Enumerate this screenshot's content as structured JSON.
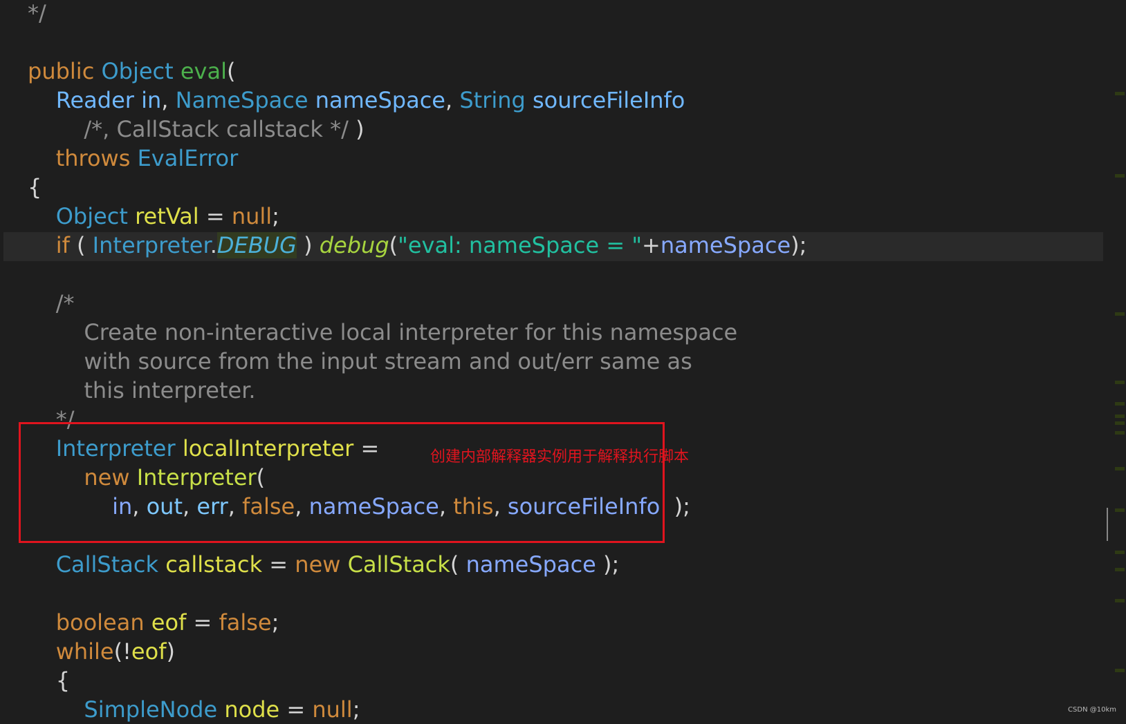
{
  "editor": {
    "lines": [
      [
        {
          "t": "*/",
          "c": "cm"
        }
      ],
      [],
      [
        {
          "t": "public ",
          "c": "kw"
        },
        {
          "t": "Object ",
          "c": "ty"
        },
        {
          "t": "eval",
          "c": "fn"
        },
        {
          "t": "(",
          "c": "pl"
        }
      ],
      [
        {
          "t": "    Reader in",
          "c": "pm"
        },
        {
          "t": ", ",
          "c": "pl"
        },
        {
          "t": "NameSpace ",
          "c": "ty"
        },
        {
          "t": "nameSpace",
          "c": "pm"
        },
        {
          "t": ", ",
          "c": "pl"
        },
        {
          "t": "String ",
          "c": "ty"
        },
        {
          "t": "sourceFileInfo",
          "c": "pm"
        }
      ],
      [
        {
          "t": "        /*, CallStack callstack */",
          "c": "cm"
        },
        {
          "t": " )",
          "c": "pl"
        }
      ],
      [
        {
          "t": "    throws ",
          "c": "kw"
        },
        {
          "t": "EvalError",
          "c": "ty"
        }
      ],
      [
        {
          "t": "{",
          "c": "pl"
        }
      ],
      [
        {
          "t": "    Object ",
          "c": "ty"
        },
        {
          "t": "retVal",
          "c": "vr"
        },
        {
          "t": " = ",
          "c": "pl"
        },
        {
          "t": "null",
          "c": "kw"
        },
        {
          "t": ";",
          "c": "pl"
        }
      ],
      [
        {
          "t": "    if",
          "c": "kw"
        },
        {
          "t": " ( ",
          "c": "pl"
        },
        {
          "t": "Interpreter",
          "c": "ty"
        },
        {
          "t": ".",
          "c": "pl"
        },
        {
          "t": "DEBUG",
          "c": "cs"
        },
        {
          "t": " ) ",
          "c": "pl"
        },
        {
          "t": "debug",
          "c": "dg"
        },
        {
          "t": "(",
          "c": "pl"
        },
        {
          "t": "\"eval: nameSpace = \"",
          "c": "st"
        },
        {
          "t": "+",
          "c": "pl"
        },
        {
          "t": "nameSpace",
          "c": "nm"
        },
        {
          "t": ");",
          "c": "pl"
        }
      ],
      [],
      [
        {
          "t": "    /*",
          "c": "cm"
        }
      ],
      [
        {
          "t": "        Create non-interactive local interpreter for this namespace",
          "c": "cm"
        }
      ],
      [
        {
          "t": "        with source from the input stream and out/err same as",
          "c": "cm"
        }
      ],
      [
        {
          "t": "        this interpreter.",
          "c": "cm"
        }
      ],
      [
        {
          "t": "    */",
          "c": "cm"
        }
      ],
      [
        {
          "t": "    Interpreter ",
          "c": "ty"
        },
        {
          "t": "localInterpreter",
          "c": "vr"
        },
        {
          "t": " =",
          "c": "pl"
        }
      ],
      [
        {
          "t": "        new ",
          "c": "kw"
        },
        {
          "t": "Interpreter",
          "c": "ct"
        },
        {
          "t": "(",
          "c": "pl"
        }
      ],
      [
        {
          "t": "            in",
          "c": "nm"
        },
        {
          "t": ", ",
          "c": "pl"
        },
        {
          "t": "out",
          "c": "ln"
        },
        {
          "t": ", ",
          "c": "pl"
        },
        {
          "t": "err",
          "c": "ln"
        },
        {
          "t": ", ",
          "c": "pl"
        },
        {
          "t": "false",
          "c": "kw"
        },
        {
          "t": ", ",
          "c": "pl"
        },
        {
          "t": "nameSpace",
          "c": "nm"
        },
        {
          "t": ", ",
          "c": "pl"
        },
        {
          "t": "this",
          "c": "kw"
        },
        {
          "t": ", ",
          "c": "pl"
        },
        {
          "t": "sourceFileInfo",
          "c": "nm"
        },
        {
          "t": "  );",
          "c": "pl"
        }
      ],
      [],
      [
        {
          "t": "    CallStack ",
          "c": "ty"
        },
        {
          "t": "callstack",
          "c": "vr"
        },
        {
          "t": " = ",
          "c": "pl"
        },
        {
          "t": "new ",
          "c": "kw"
        },
        {
          "t": "CallStack",
          "c": "ct"
        },
        {
          "t": "( ",
          "c": "pl"
        },
        {
          "t": "nameSpace",
          "c": "nm"
        },
        {
          "t": " );",
          "c": "pl"
        }
      ],
      [],
      [
        {
          "t": "    boolean ",
          "c": "kw"
        },
        {
          "t": "eof",
          "c": "vr"
        },
        {
          "t": " = ",
          "c": "pl"
        },
        {
          "t": "false",
          "c": "kw"
        },
        {
          "t": ";",
          "c": "pl"
        }
      ],
      [
        {
          "t": "    while",
          "c": "kw"
        },
        {
          "t": "(!",
          "c": "pl"
        },
        {
          "t": "eof",
          "c": "vr"
        },
        {
          "t": ")",
          "c": "pl"
        }
      ],
      [
        {
          "t": "    {",
          "c": "pl"
        }
      ],
      [
        {
          "t": "        SimpleNode ",
          "c": "ty"
        },
        {
          "t": "node",
          "c": "vr"
        },
        {
          "t": " = ",
          "c": "pl"
        },
        {
          "t": "null",
          "c": "kw"
        },
        {
          "t": ";",
          "c": "pl"
        }
      ]
    ]
  },
  "annotation": {
    "text": "创建内部解释器实例用于解释执行脚本"
  },
  "watermark": {
    "text": "CSDN @10km"
  }
}
